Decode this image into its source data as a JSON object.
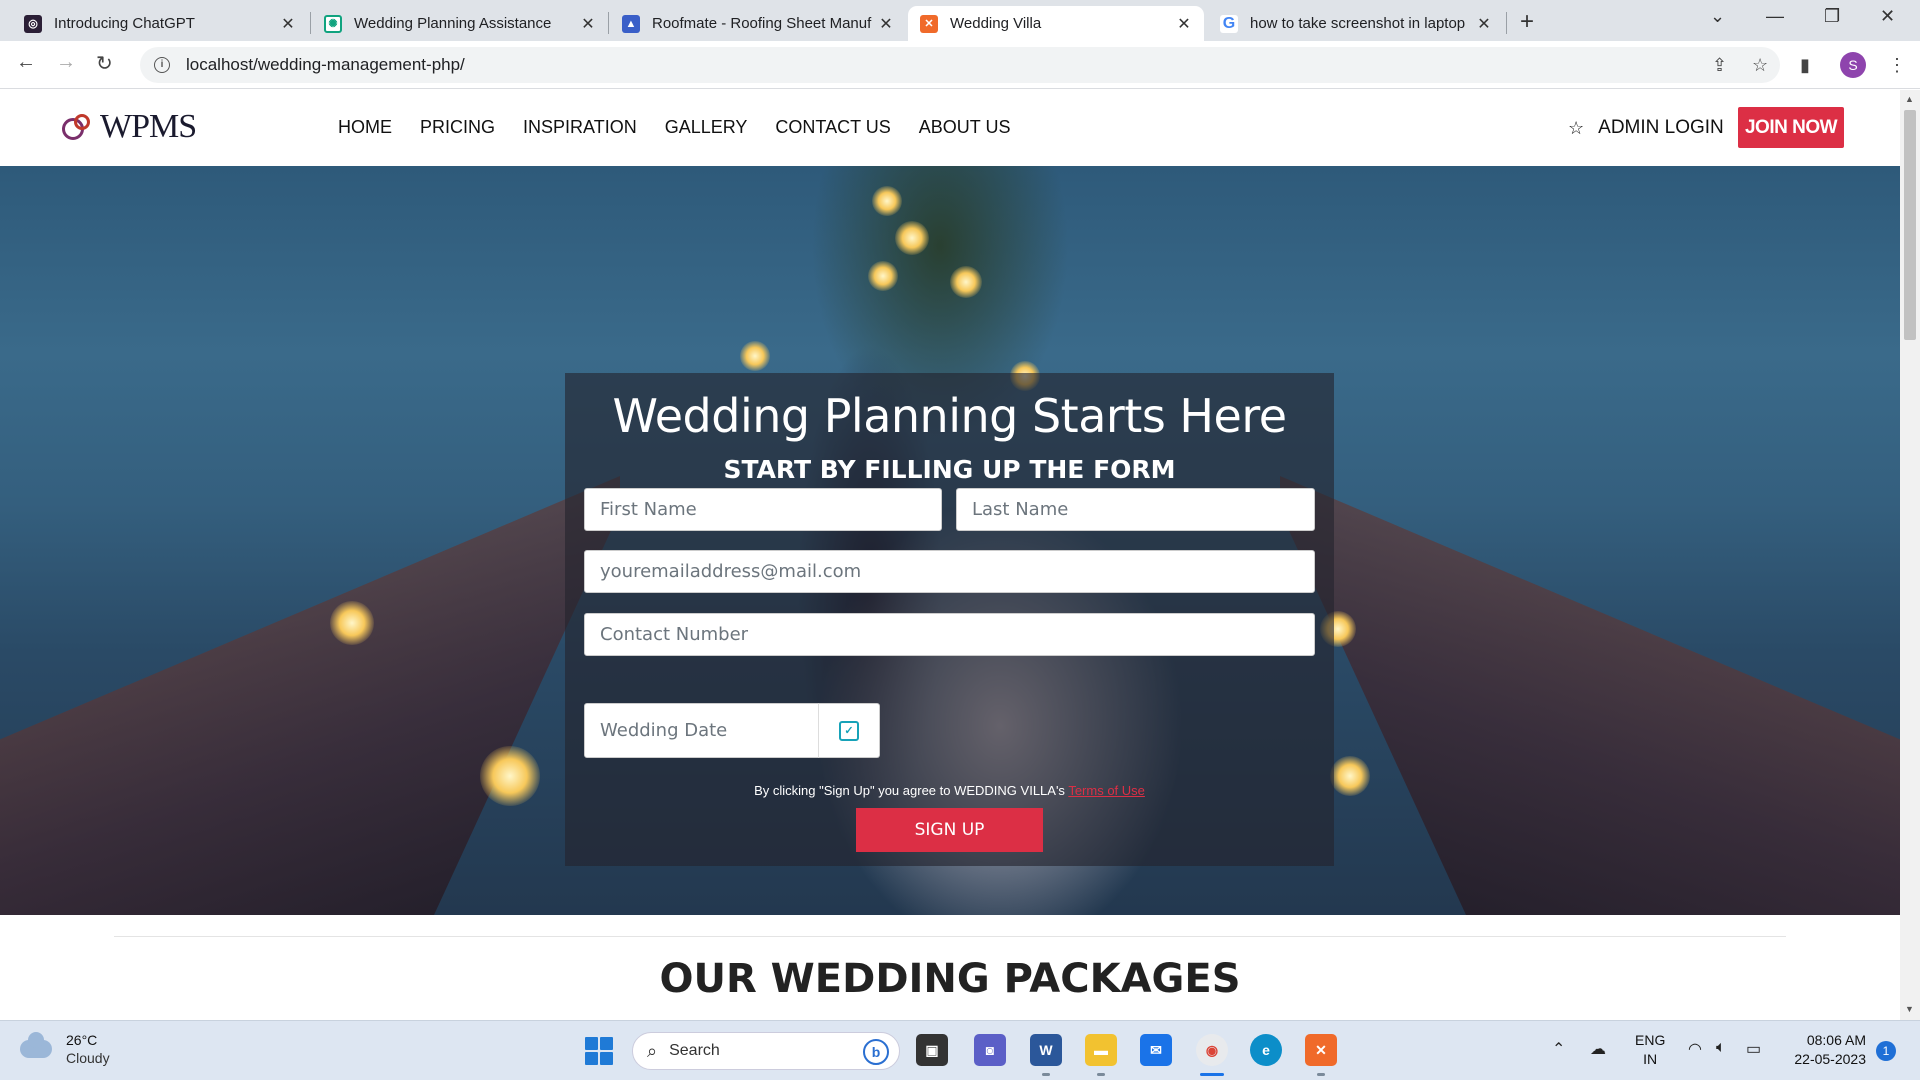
{
  "browser": {
    "tabs": [
      {
        "title": "Introducing ChatGPT",
        "active": false
      },
      {
        "title": "Wedding Planning Assistance",
        "active": false
      },
      {
        "title": "Roofmate - Roofing Sheet Manuf",
        "active": false
      },
      {
        "title": "Wedding Villa",
        "active": true
      },
      {
        "title": "how to take screenshot in laptop",
        "active": false
      }
    ],
    "url": "localhost/wedding-management-php/",
    "profile_initial": "S"
  },
  "site": {
    "logo": "WPMS",
    "menu": [
      "HOME",
      "PRICING",
      "INSPIRATION",
      "GALLERY",
      "CONTACT US",
      "ABOUT US"
    ],
    "admin_login": "ADMIN LOGIN",
    "join_now": "JOIN NOW"
  },
  "form": {
    "title": "Wedding Planning Starts Here",
    "subtitle": "START BY FILLING UP THE FORM",
    "first_name_placeholder": "First Name",
    "last_name_placeholder": "Last Name",
    "email_placeholder": "youremailaddress@mail.com",
    "contact_placeholder": "Contact Number",
    "wedding_date_placeholder": "Wedding Date",
    "agree_text": "By clicking \"Sign Up\" you agree to WEDDING VILLA's ",
    "terms_text": "Terms of Use",
    "signup_label": "SIGN UP"
  },
  "packages": {
    "title": "OUR WEDDING PACKAGES"
  },
  "taskbar": {
    "weather_temp": "26°C",
    "weather_desc": "Cloudy",
    "search_label": "Search",
    "lang_line1": "ENG",
    "lang_line2": "IN",
    "time": "08:06 AM",
    "date": "22-05-2023",
    "notification_count": "1"
  },
  "colors": {
    "accent": "#dc2f45",
    "calendar_icon": "#17a2b8"
  }
}
